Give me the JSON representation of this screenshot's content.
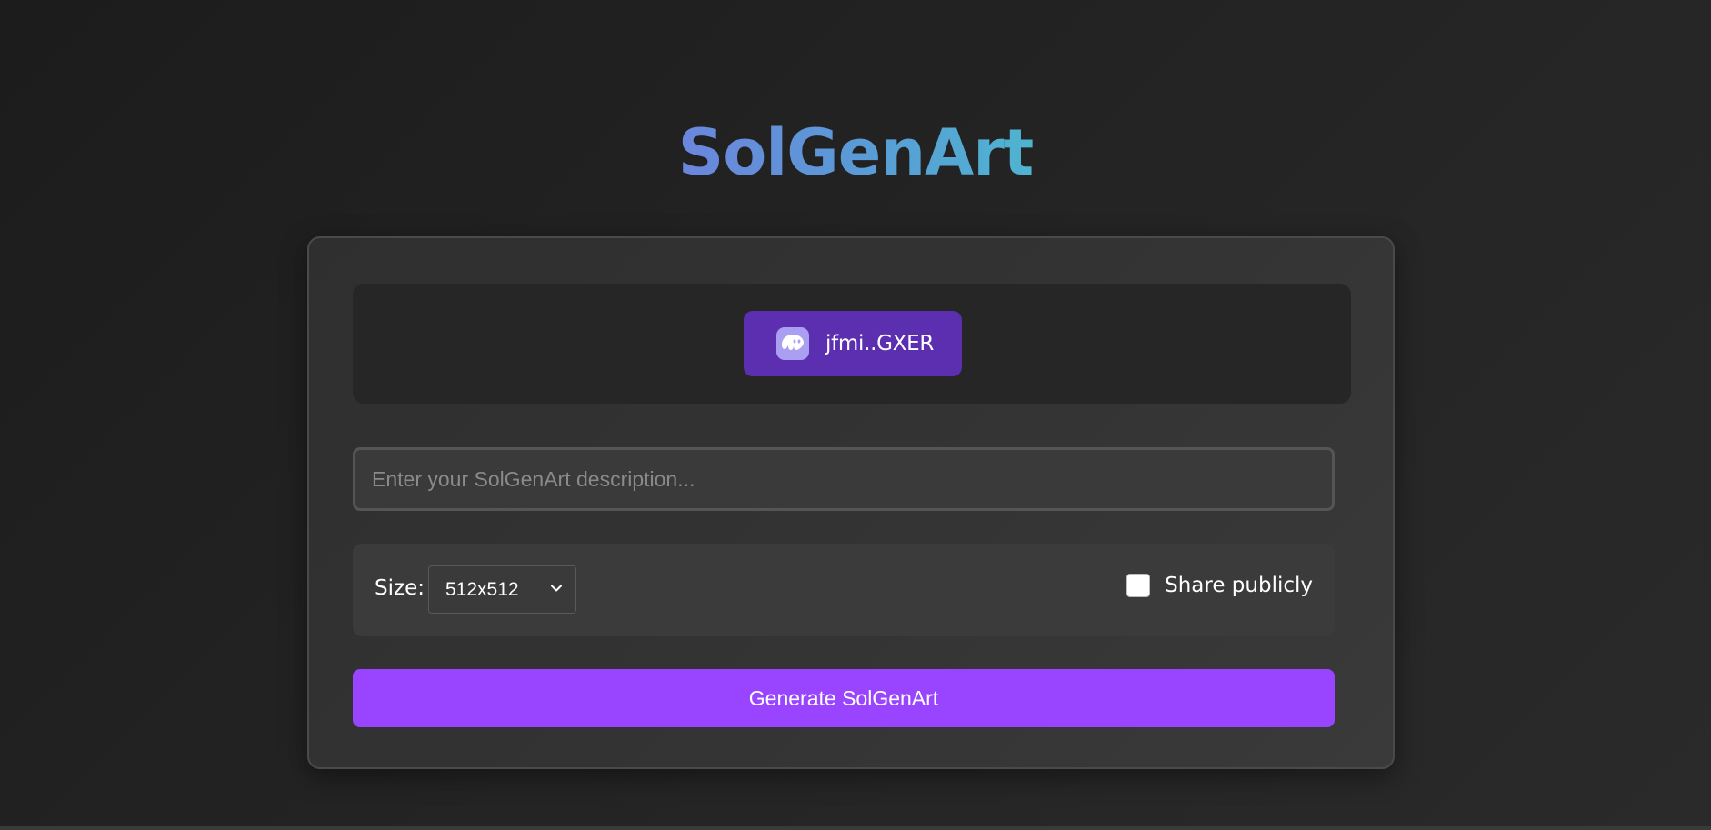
{
  "app": {
    "title": "SolGenArt"
  },
  "wallet": {
    "address_label": "jfmi..GXER",
    "icon": "phantom-ghost-icon",
    "button_color": "#5b2fb0"
  },
  "prompt": {
    "placeholder": "Enter your SolGenArt description...",
    "value": ""
  },
  "options": {
    "size_label": "Size:",
    "size_value": "512x512",
    "share_label": "Share publicly",
    "share_checked": false
  },
  "actions": {
    "generate_label": "Generate SolGenArt",
    "generate_color": "#9945ff"
  },
  "colors": {
    "title_gradient_start": "#6b86dc",
    "title_gradient_end": "#4fb4d0",
    "background": "#222222"
  }
}
